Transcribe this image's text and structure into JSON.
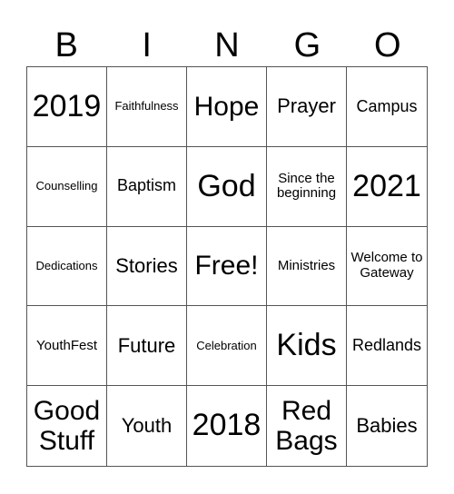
{
  "header": {
    "letters": [
      "B",
      "I",
      "N",
      "G",
      "O"
    ]
  },
  "card": {
    "cells": [
      {
        "text": "2019",
        "size": "s-xxl"
      },
      {
        "text": "Faithfulness",
        "size": "s-xs"
      },
      {
        "text": "Hope",
        "size": "s-xl"
      },
      {
        "text": "Prayer",
        "size": "s-lg"
      },
      {
        "text": "Campus",
        "size": "s-md"
      },
      {
        "text": "Counselling",
        "size": "s-xs"
      },
      {
        "text": "Baptism",
        "size": "s-md"
      },
      {
        "text": "God",
        "size": "s-xxl"
      },
      {
        "text": "Since the beginning",
        "size": "s-sm"
      },
      {
        "text": "2021",
        "size": "s-xxl"
      },
      {
        "text": "Dedications",
        "size": "s-xs"
      },
      {
        "text": "Stories",
        "size": "s-lg"
      },
      {
        "text": "Free!",
        "size": "s-xl"
      },
      {
        "text": "Ministries",
        "size": "s-sm"
      },
      {
        "text": "Welcome to Gateway",
        "size": "s-sm"
      },
      {
        "text": "YouthFest",
        "size": "s-sm"
      },
      {
        "text": "Future",
        "size": "s-lg"
      },
      {
        "text": "Celebration",
        "size": "s-xs"
      },
      {
        "text": "Kids",
        "size": "s-xxl"
      },
      {
        "text": "Redlands",
        "size": "s-md"
      },
      {
        "text": "Good Stuff",
        "size": "s-xl"
      },
      {
        "text": "Youth",
        "size": "s-lg"
      },
      {
        "text": "2018",
        "size": "s-xxl"
      },
      {
        "text": "Red Bags",
        "size": "s-xl"
      },
      {
        "text": "Babies",
        "size": "s-lg"
      }
    ]
  }
}
